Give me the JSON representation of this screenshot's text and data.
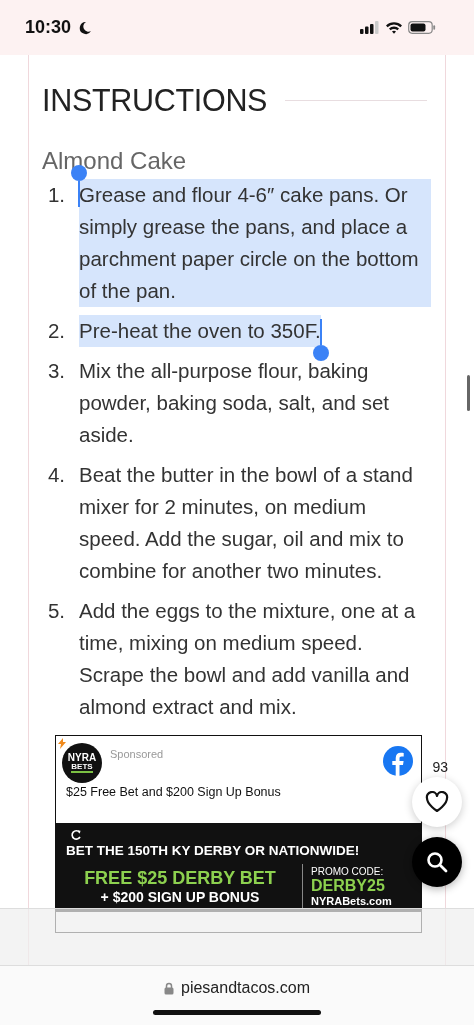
{
  "status_bar": {
    "time": "10:30"
  },
  "section": {
    "title": "INSTRUCTIONS",
    "subtitle": "Almond Cake"
  },
  "steps": [
    {
      "number": "1.",
      "text": "Grease and flour 4-6″ cake pans. Or simply grease the pans, and place a parchment paper circle on the bottom of the pan.",
      "selected": true
    },
    {
      "number": "2.",
      "text": "Pre-heat the oven to 350F.",
      "selected": true
    },
    {
      "number": "3.",
      "text": "Mix the all-purpose flour, baking powder, baking soda, salt, and set aside.",
      "selected": false
    },
    {
      "number": "4.",
      "text": "Beat the butter in the bowl of a stand mixer for 2 minutes, on medium speed. Add the sugar, oil and mix to combine for another two minutes.",
      "selected": false
    },
    {
      "number": "5.",
      "text": "Add the eggs to the mixture, one at a time, mixing on medium speed. Scrape the bowl and add vanilla and almond extract and mix.",
      "selected": false
    }
  ],
  "ad": {
    "logo_top": "NYRA",
    "logo_bottom": "BETS",
    "sponsored": "Sponsored",
    "headline": "$25 Free Bet and $200 Sign Up Bonus",
    "banner_title": "BET THE 150TH KY DERBY OR NATIONWIDE!",
    "offer_line_1": "FREE $25 DERBY BET",
    "offer_line_2": "+ $200 SIGN UP BONUS",
    "promo_label": "PROMO CODE:",
    "promo_code": "DERBY25",
    "promo_site": "NYRABets.com"
  },
  "like_count": "93",
  "browser": {
    "url": "piesandtacos.com"
  }
}
